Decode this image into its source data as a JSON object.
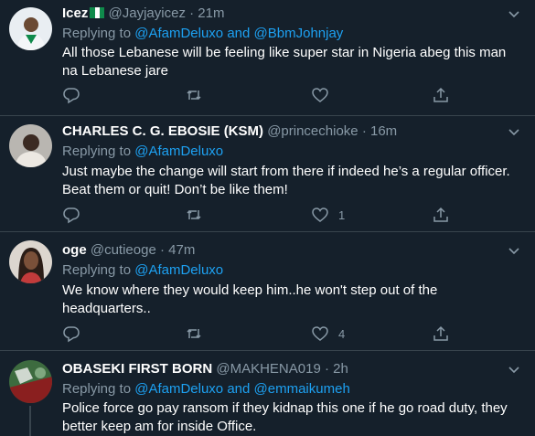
{
  "replying_prefix": "Replying to",
  "and_word": "and",
  "tweets": [
    {
      "name": "Icez",
      "handle": "@Jayjayicez",
      "time": "21m",
      "mentions": [
        "@AfamDeluxo",
        "@BbmJohnjay"
      ],
      "text": "All those Lebanese will be feeling like super star in Nigeria abeg this man na Lebanese jare",
      "likes": ""
    },
    {
      "name": "CHARLES C. G. EBOSIE (KSM)",
      "handle": "@princechioke",
      "time": "16m",
      "mentions": [
        "@AfamDeluxo"
      ],
      "text": "Just maybe the change will start from there if indeed he’s a regular officer. Beat them or quit! Don’t be like them!",
      "likes": "1"
    },
    {
      "name": "oge",
      "handle": "@cutieoge",
      "time": "47m",
      "mentions": [
        "@AfamDeluxo"
      ],
      "text": "We know where they would keep him..he won't step out of the headquarters..",
      "likes": "4"
    },
    {
      "name": "OBASEKI FIRST BORN",
      "handle": "@MAKHENA019",
      "time": "2h",
      "mentions": [
        "@AfamDeluxo",
        "@emmaikumeh"
      ],
      "text": "Police force go pay ransom if they kidnap this one if he go road duty, they better keep am for inside Office.",
      "likes": ""
    }
  ],
  "icons": {
    "reply": "reply-icon",
    "retweet": "retweet-icon",
    "like": "heart-icon",
    "share": "share-icon",
    "more": "chevron-down-icon",
    "flag": "nigeria-flag-icon"
  },
  "colors": {
    "background": "#15202b",
    "divider": "#38444d",
    "secondary_text": "#8899a6",
    "link": "#1da1f2"
  }
}
